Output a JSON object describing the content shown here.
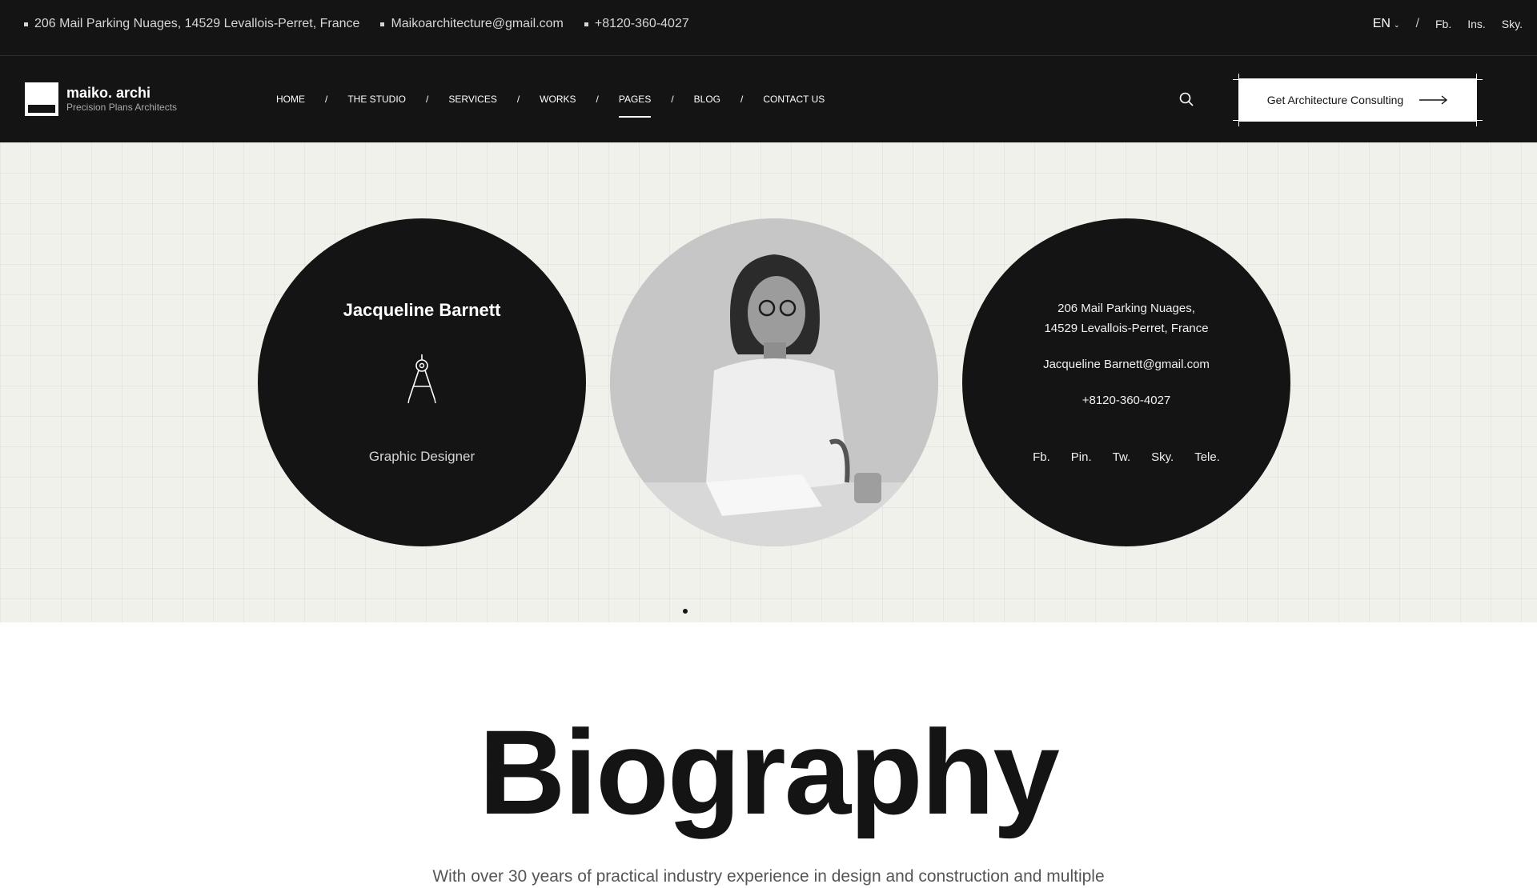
{
  "topbar": {
    "address": "206 Mail Parking Nuages, 14529 Levallois-Perret, France",
    "email": "Maikoarchitecture@gmail.com",
    "phone": "+8120-360-4027",
    "language": "EN",
    "separator": "/",
    "socials": [
      "Fb.",
      "Ins.",
      "Sky."
    ]
  },
  "brand": {
    "name": "maiko. archi",
    "tagline": "Precision Plans Architects"
  },
  "nav": {
    "items": [
      "HOME",
      "THE STUDIO",
      "SERVICES",
      "WORKS",
      "PAGES",
      "BLOG",
      "CONTACT US"
    ],
    "separator": "/",
    "active": "PAGES",
    "cta_label": "Get Architecture Consulting"
  },
  "profile": {
    "name": "Jacqueline Barnett",
    "role": "Graphic Designer",
    "address_line1": "206 Mail Parking Nuages,",
    "address_line2": "14529 Levallois-Perret, France",
    "email": "Jacqueline Barnett@gmail.com",
    "phone": "+8120-360-4027",
    "socials": [
      "Fb.",
      "Pin.",
      "Tw.",
      "Sky.",
      "Tele."
    ],
    "slider_pages": 1,
    "slider_current": 1
  },
  "biography": {
    "title": "Biography",
    "intro": "With over 30 years of practical industry experience in design and construction and multiple"
  },
  "colors": {
    "dark": "#141414",
    "light_bg": "#f1f1ec",
    "white": "#ffffff"
  }
}
